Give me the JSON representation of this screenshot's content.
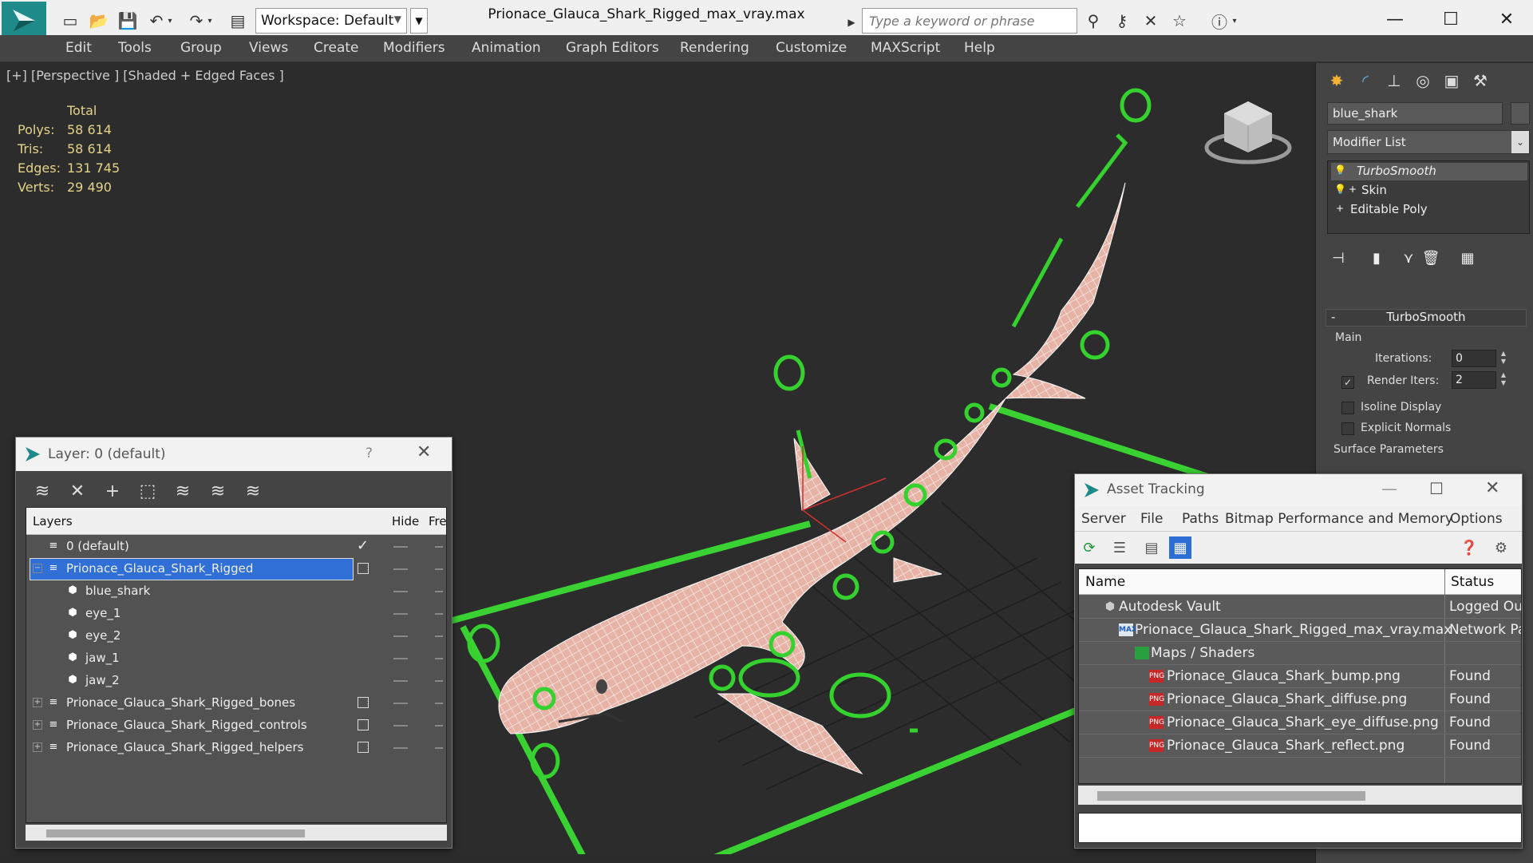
{
  "titlebar": {
    "workspace": "Workspace: Default",
    "doc_title": "Prionace_Glauca_Shark_Rigged_max_vray.max",
    "search_placeholder": "Type a keyword or phrase"
  },
  "menubar": [
    "Edit",
    "Tools",
    "Group",
    "Views",
    "Create",
    "Modifiers",
    "Animation",
    "Graph Editors",
    "Rendering",
    "Customize",
    "MAXScript",
    "Help"
  ],
  "viewport": {
    "label": "[+] [Perspective ] [Shaded + Edged Faces ]",
    "stats": {
      "header": "Total",
      "rows": [
        {
          "label": "Polys:",
          "value": "58 614"
        },
        {
          "label": "Tris:",
          "value": "58 614"
        },
        {
          "label": "Edges:",
          "value": "131 745"
        },
        {
          "label": "Verts:",
          "value": "29 490"
        }
      ]
    }
  },
  "command_panel": {
    "object_name": "blue_shark",
    "modifier_list": "Modifier List",
    "stack": [
      "TurboSmooth",
      "Skin",
      "Editable Poly"
    ],
    "rollout": {
      "title": "TurboSmooth",
      "group": "Main",
      "iterations_label": "Iterations:",
      "iterations_value": "0",
      "render_iters_label": "Render Iters:",
      "render_iters_value": "2",
      "isoline": "Isoline Display",
      "explicit": "Explicit Normals",
      "surface": "Surface Parameters"
    }
  },
  "layer_window": {
    "title": "Layer: 0 (default)",
    "help": "?",
    "columns": {
      "layers": "Layers",
      "hide": "Hide",
      "freeze": "Fre"
    },
    "rows": [
      {
        "name": "0 (default)",
        "level": 0
      },
      {
        "name": "Prionace_Glauca_Shark_Rigged",
        "level": 0
      },
      {
        "name": "blue_shark",
        "level": 1
      },
      {
        "name": "eye_1",
        "level": 1
      },
      {
        "name": "eye_2",
        "level": 1
      },
      {
        "name": "jaw_1",
        "level": 1
      },
      {
        "name": "jaw_2",
        "level": 1
      },
      {
        "name": "Prionace_Glauca_Shark_Rigged_bones",
        "level": 0
      },
      {
        "name": "Prionace_Glauca_Shark_Rigged_controls",
        "level": 0
      },
      {
        "name": "Prionace_Glauca_Shark_Rigged_helpers",
        "level": 0
      }
    ]
  },
  "asset_window": {
    "title": "Asset Tracking",
    "menu": [
      "Server",
      "File",
      "Paths",
      "Bitmap Performance and Memory",
      "Options"
    ],
    "columns": {
      "name": "Name",
      "status": "Status"
    },
    "rows": [
      {
        "name": "Autodesk Vault",
        "status": "Logged Out"
      },
      {
        "name": "Prionace_Glauca_Shark_Rigged_max_vray.max",
        "status": "Network Pat"
      },
      {
        "name": "Maps / Shaders",
        "status": ""
      },
      {
        "name": "Prionace_Glauca_Shark_bump.png",
        "status": "Found"
      },
      {
        "name": "Prionace_Glauca_Shark_diffuse.png",
        "status": "Found"
      },
      {
        "name": "Prionace_Glauca_Shark_eye_diffuse.png",
        "status": "Found"
      },
      {
        "name": "Prionace_Glauca_Shark_reflect.png",
        "status": "Found"
      }
    ]
  },
  "icons": {
    "png_badge": "PNG",
    "max_badge": "MAX"
  },
  "colors": {
    "accent": "#2f6fd6",
    "rig_green": "#35d12e",
    "mesh_pink": "#e8b8ac",
    "stats": "#e3d38a"
  }
}
